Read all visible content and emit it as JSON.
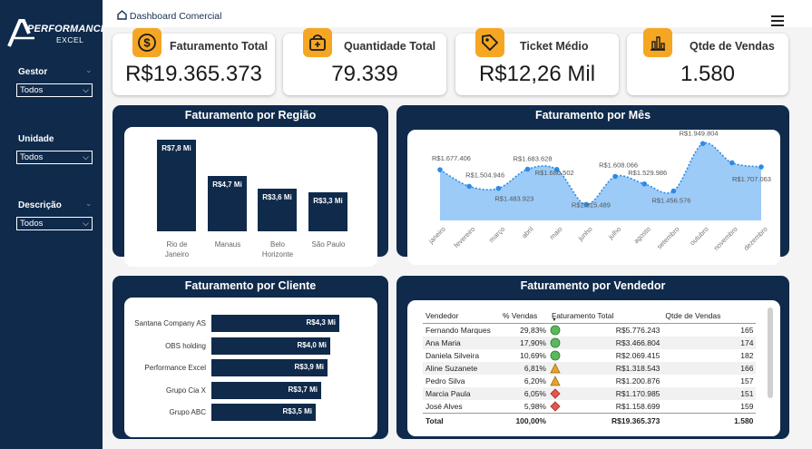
{
  "logo": {
    "main": "PERFORMANCE",
    "sub": "EXCEL"
  },
  "sidebar": {
    "filters": [
      {
        "label": "Gestor",
        "value": "Todos"
      },
      {
        "label": "Unidade",
        "value": "Todos"
      },
      {
        "label": "Descrição",
        "value": "Todos"
      }
    ]
  },
  "header": {
    "breadcrumb": "Dashboard Comercial",
    "home_icon": "home-icon",
    "menu_icon": "hamburger-menu-icon"
  },
  "colors": {
    "navy": "#0f2a4b",
    "accent": "#f5a623",
    "area": "#9ccbf7",
    "line": "#2d8ae6"
  },
  "kpis": [
    {
      "label": "Faturamento Total",
      "value": "R$19.365.373",
      "icon": "dollar-coin-icon"
    },
    {
      "label": "Quantidade Total",
      "value": "79.339",
      "icon": "shopping-bag-icon"
    },
    {
      "label": "Ticket Médio",
      "value": "R$12,26 Mil",
      "icon": "price-tag-icon"
    },
    {
      "label": "Qtde de Vendas",
      "value": "1.580",
      "icon": "bar-chart-icon"
    }
  ],
  "chart_data": [
    {
      "type": "bar",
      "title": "Faturamento por Região",
      "categories": [
        "Rio de Janeiro",
        "Manaus",
        "Belo Horizonte",
        "São Paulo"
      ],
      "values": [
        7.8,
        4.7,
        3.6,
        3.3
      ],
      "data_labels": [
        "R$7,8 Mi",
        "R$4,7 Mi",
        "R$3,6 Mi",
        "R$3,3 Mi"
      ],
      "unit": "Mi"
    },
    {
      "type": "area",
      "title": "Faturamento por Mês",
      "categories": [
        "janeiro",
        "fevereiro",
        "março",
        "abril",
        "maio",
        "junho",
        "julho",
        "agosto",
        "setembro",
        "outubro",
        "novembro",
        "dezembro"
      ],
      "values": [
        1677406,
        1504946,
        1483923,
        1683628,
        1680502,
        1315489,
        1608066,
        1529986,
        1456576,
        1949804,
        1750000,
        1707063
      ],
      "data_labels": [
        "R$1.677.406",
        "R$1.504.946",
        "R$1.483.923",
        "R$1.683.628",
        "R$1.680.502",
        "R$1.315.489",
        "R$1.608.066",
        "R$1.529.986",
        "R$1.456.576",
        "R$1.949.804",
        "",
        "R$1.707.063"
      ],
      "ylim": [
        1150000,
        2000000
      ]
    },
    {
      "type": "bar",
      "orientation": "horizontal",
      "title": "Faturamento por Cliente",
      "categories": [
        "Santana Company AS",
        "OBS holding",
        "Performance Excel",
        "Grupo Cia X",
        "Grupo ABC"
      ],
      "values": [
        4.3,
        4.0,
        3.9,
        3.7,
        3.5
      ],
      "data_labels": [
        "R$4,3 Mi",
        "R$4,0 Mi",
        "R$3,9 Mi",
        "R$3,7 Mi",
        "R$3,5 Mi"
      ],
      "unit": "Mi"
    }
  ],
  "vendedor": {
    "title": "Faturamento por Vendedor",
    "headers": [
      "Vendedor",
      "% Vendas",
      "Faturamento Total",
      "Qtde de Vendas"
    ],
    "rows": [
      {
        "name": "Fernando Marques",
        "pct": "29,83%",
        "status": "green-circle",
        "fat": "R$5.776.243",
        "qtd": "165"
      },
      {
        "name": "Ana Maria",
        "pct": "17,90%",
        "status": "green-circle",
        "fat": "R$3.466.804",
        "qtd": "174"
      },
      {
        "name": "Daniela Silveira",
        "pct": "10,69%",
        "status": "green-circle",
        "fat": "R$2.069.415",
        "qtd": "182"
      },
      {
        "name": "Aline Suzanete",
        "pct": "6,81%",
        "status": "yellow-triangle",
        "fat": "R$1.318.543",
        "qtd": "166"
      },
      {
        "name": "Pedro Silva",
        "pct": "6,20%",
        "status": "yellow-triangle",
        "fat": "R$1.200.876",
        "qtd": "157"
      },
      {
        "name": "Marcia Paula",
        "pct": "6,05%",
        "status": "red-diamond",
        "fat": "R$1.170.985",
        "qtd": "151"
      },
      {
        "name": "José Alves",
        "pct": "5,98%",
        "status": "red-diamond",
        "fat": "R$1.158.699",
        "qtd": "159"
      }
    ],
    "total": {
      "label": "Total",
      "pct": "100,00%",
      "fat": "R$19.365.373",
      "qtd": "1.580"
    }
  }
}
